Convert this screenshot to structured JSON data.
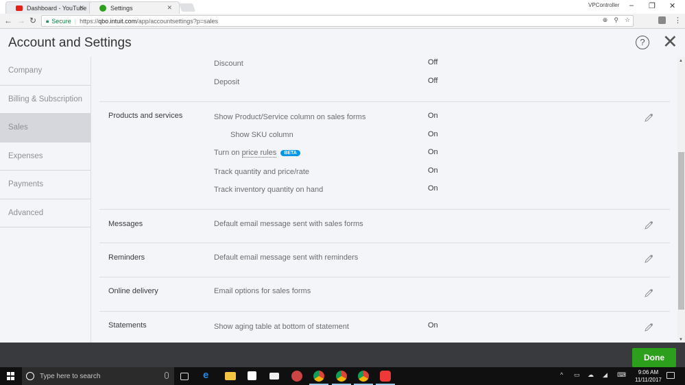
{
  "browser": {
    "tabs": [
      {
        "label": "Dashboard - YouTube",
        "favicon": "youtube-icon",
        "active": false
      },
      {
        "label": "Settings",
        "favicon": "quickbooks-icon",
        "active": true
      }
    ],
    "window_title": "VPController",
    "url": {
      "secure_label": "Secure",
      "scheme": "https://",
      "host": "qbo.intuit.com",
      "path": "/app/accountsettings?p=sales"
    }
  },
  "page": {
    "title": "Account and Settings",
    "help_icon": "?",
    "close_icon": "✕"
  },
  "sidebar": {
    "items": [
      {
        "label": "Company",
        "selected": false
      },
      {
        "label": "Billing & Subscription",
        "selected": false
      },
      {
        "label": "Sales",
        "selected": true
      },
      {
        "label": "Expenses",
        "selected": false
      },
      {
        "label": "Payments",
        "selected": false
      },
      {
        "label": "Advanced",
        "selected": false
      }
    ]
  },
  "sections": {
    "sales_form_content_tail": {
      "settings": [
        {
          "label": "Discount",
          "value": "Off"
        },
        {
          "label": "Deposit",
          "value": "Off"
        }
      ]
    },
    "products_and_services": {
      "title": "Products and services",
      "settings": [
        {
          "label": "Show Product/Service column on sales forms",
          "value": "On"
        },
        {
          "label": "Show SKU column",
          "value": "On"
        },
        {
          "label_prefix": "Turn on ",
          "label_link": "price rules",
          "badge": "BETA",
          "value": "On"
        },
        {
          "label": "Track quantity and price/rate",
          "value": "On"
        },
        {
          "label": "Track inventory quantity on hand",
          "value": "On"
        }
      ]
    },
    "messages": {
      "title": "Messages",
      "description": "Default email message sent with sales forms"
    },
    "reminders": {
      "title": "Reminders",
      "description": "Default email message sent with reminders"
    },
    "online_delivery": {
      "title": "Online delivery",
      "description": "Email options for sales forms"
    },
    "statements": {
      "title": "Statements",
      "description": "Show aging table at bottom of statement",
      "value": "On"
    }
  },
  "footer": {
    "done_label": "Done"
  },
  "taskbar": {
    "search_placeholder": "Type here to search",
    "time": "9:06 AM",
    "date": "11/11/2017"
  },
  "colors": {
    "brand_green": "#2ca01c",
    "beta_blue": "#0097e6",
    "footer_bg": "#393a3d"
  }
}
